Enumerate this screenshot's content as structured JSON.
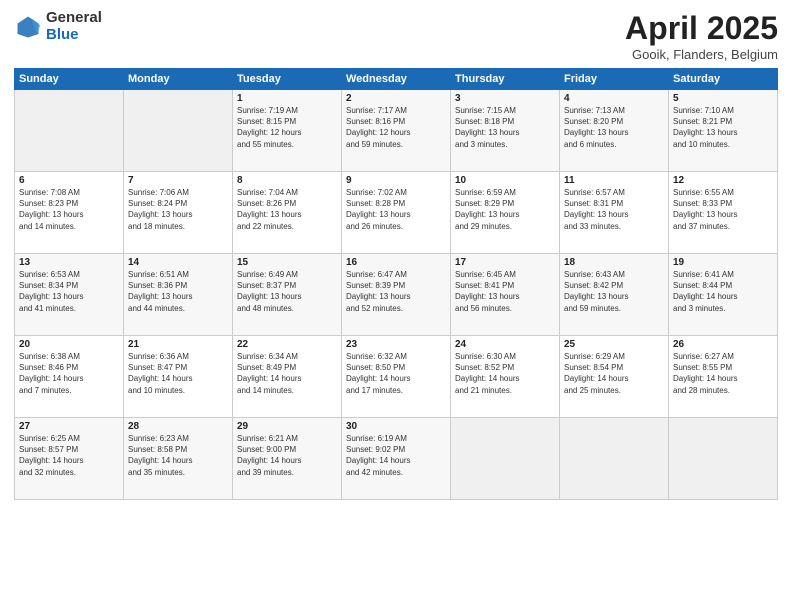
{
  "logo": {
    "general": "General",
    "blue": "Blue"
  },
  "title": "April 2025",
  "subtitle": "Gooik, Flanders, Belgium",
  "weekdays": [
    "Sunday",
    "Monday",
    "Tuesday",
    "Wednesday",
    "Thursday",
    "Friday",
    "Saturday"
  ],
  "weeks": [
    [
      {
        "day": "",
        "info": ""
      },
      {
        "day": "",
        "info": ""
      },
      {
        "day": "1",
        "info": "Sunrise: 7:19 AM\nSunset: 8:15 PM\nDaylight: 12 hours\nand 55 minutes."
      },
      {
        "day": "2",
        "info": "Sunrise: 7:17 AM\nSunset: 8:16 PM\nDaylight: 12 hours\nand 59 minutes."
      },
      {
        "day": "3",
        "info": "Sunrise: 7:15 AM\nSunset: 8:18 PM\nDaylight: 13 hours\nand 3 minutes."
      },
      {
        "day": "4",
        "info": "Sunrise: 7:13 AM\nSunset: 8:20 PM\nDaylight: 13 hours\nand 6 minutes."
      },
      {
        "day": "5",
        "info": "Sunrise: 7:10 AM\nSunset: 8:21 PM\nDaylight: 13 hours\nand 10 minutes."
      }
    ],
    [
      {
        "day": "6",
        "info": "Sunrise: 7:08 AM\nSunset: 8:23 PM\nDaylight: 13 hours\nand 14 minutes."
      },
      {
        "day": "7",
        "info": "Sunrise: 7:06 AM\nSunset: 8:24 PM\nDaylight: 13 hours\nand 18 minutes."
      },
      {
        "day": "8",
        "info": "Sunrise: 7:04 AM\nSunset: 8:26 PM\nDaylight: 13 hours\nand 22 minutes."
      },
      {
        "day": "9",
        "info": "Sunrise: 7:02 AM\nSunset: 8:28 PM\nDaylight: 13 hours\nand 26 minutes."
      },
      {
        "day": "10",
        "info": "Sunrise: 6:59 AM\nSunset: 8:29 PM\nDaylight: 13 hours\nand 29 minutes."
      },
      {
        "day": "11",
        "info": "Sunrise: 6:57 AM\nSunset: 8:31 PM\nDaylight: 13 hours\nand 33 minutes."
      },
      {
        "day": "12",
        "info": "Sunrise: 6:55 AM\nSunset: 8:33 PM\nDaylight: 13 hours\nand 37 minutes."
      }
    ],
    [
      {
        "day": "13",
        "info": "Sunrise: 6:53 AM\nSunset: 8:34 PM\nDaylight: 13 hours\nand 41 minutes."
      },
      {
        "day": "14",
        "info": "Sunrise: 6:51 AM\nSunset: 8:36 PM\nDaylight: 13 hours\nand 44 minutes."
      },
      {
        "day": "15",
        "info": "Sunrise: 6:49 AM\nSunset: 8:37 PM\nDaylight: 13 hours\nand 48 minutes."
      },
      {
        "day": "16",
        "info": "Sunrise: 6:47 AM\nSunset: 8:39 PM\nDaylight: 13 hours\nand 52 minutes."
      },
      {
        "day": "17",
        "info": "Sunrise: 6:45 AM\nSunset: 8:41 PM\nDaylight: 13 hours\nand 56 minutes."
      },
      {
        "day": "18",
        "info": "Sunrise: 6:43 AM\nSunset: 8:42 PM\nDaylight: 13 hours\nand 59 minutes."
      },
      {
        "day": "19",
        "info": "Sunrise: 6:41 AM\nSunset: 8:44 PM\nDaylight: 14 hours\nand 3 minutes."
      }
    ],
    [
      {
        "day": "20",
        "info": "Sunrise: 6:38 AM\nSunset: 8:46 PM\nDaylight: 14 hours\nand 7 minutes."
      },
      {
        "day": "21",
        "info": "Sunrise: 6:36 AM\nSunset: 8:47 PM\nDaylight: 14 hours\nand 10 minutes."
      },
      {
        "day": "22",
        "info": "Sunrise: 6:34 AM\nSunset: 8:49 PM\nDaylight: 14 hours\nand 14 minutes."
      },
      {
        "day": "23",
        "info": "Sunrise: 6:32 AM\nSunset: 8:50 PM\nDaylight: 14 hours\nand 17 minutes."
      },
      {
        "day": "24",
        "info": "Sunrise: 6:30 AM\nSunset: 8:52 PM\nDaylight: 14 hours\nand 21 minutes."
      },
      {
        "day": "25",
        "info": "Sunrise: 6:29 AM\nSunset: 8:54 PM\nDaylight: 14 hours\nand 25 minutes."
      },
      {
        "day": "26",
        "info": "Sunrise: 6:27 AM\nSunset: 8:55 PM\nDaylight: 14 hours\nand 28 minutes."
      }
    ],
    [
      {
        "day": "27",
        "info": "Sunrise: 6:25 AM\nSunset: 8:57 PM\nDaylight: 14 hours\nand 32 minutes."
      },
      {
        "day": "28",
        "info": "Sunrise: 6:23 AM\nSunset: 8:58 PM\nDaylight: 14 hours\nand 35 minutes."
      },
      {
        "day": "29",
        "info": "Sunrise: 6:21 AM\nSunset: 9:00 PM\nDaylight: 14 hours\nand 39 minutes."
      },
      {
        "day": "30",
        "info": "Sunrise: 6:19 AM\nSunset: 9:02 PM\nDaylight: 14 hours\nand 42 minutes."
      },
      {
        "day": "",
        "info": ""
      },
      {
        "day": "",
        "info": ""
      },
      {
        "day": "",
        "info": ""
      }
    ]
  ]
}
